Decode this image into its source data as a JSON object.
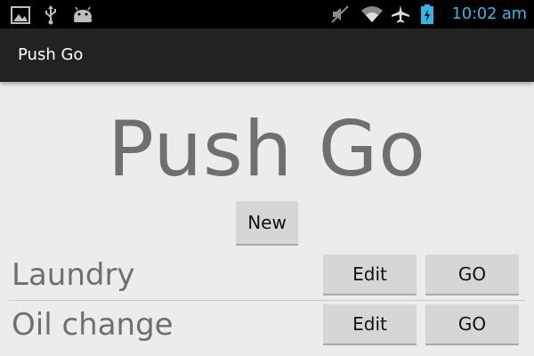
{
  "status_bar": {
    "left_icons": [
      "gallery-icon",
      "usb-icon",
      "android-icon"
    ],
    "right_icons": [
      "mute-icon",
      "wifi-icon",
      "airplane-mode-icon",
      "battery-charging-icon"
    ],
    "time": "10:02 am",
    "accent_color": "#33b5e5"
  },
  "action_bar": {
    "title": "Push Go"
  },
  "main": {
    "title": "Push Go",
    "new_button_label": "New",
    "items": [
      {
        "label": "Laundry",
        "edit_label": "Edit",
        "go_label": "GO"
      },
      {
        "label": "Oil change",
        "edit_label": "Edit",
        "go_label": "GO"
      }
    ]
  }
}
